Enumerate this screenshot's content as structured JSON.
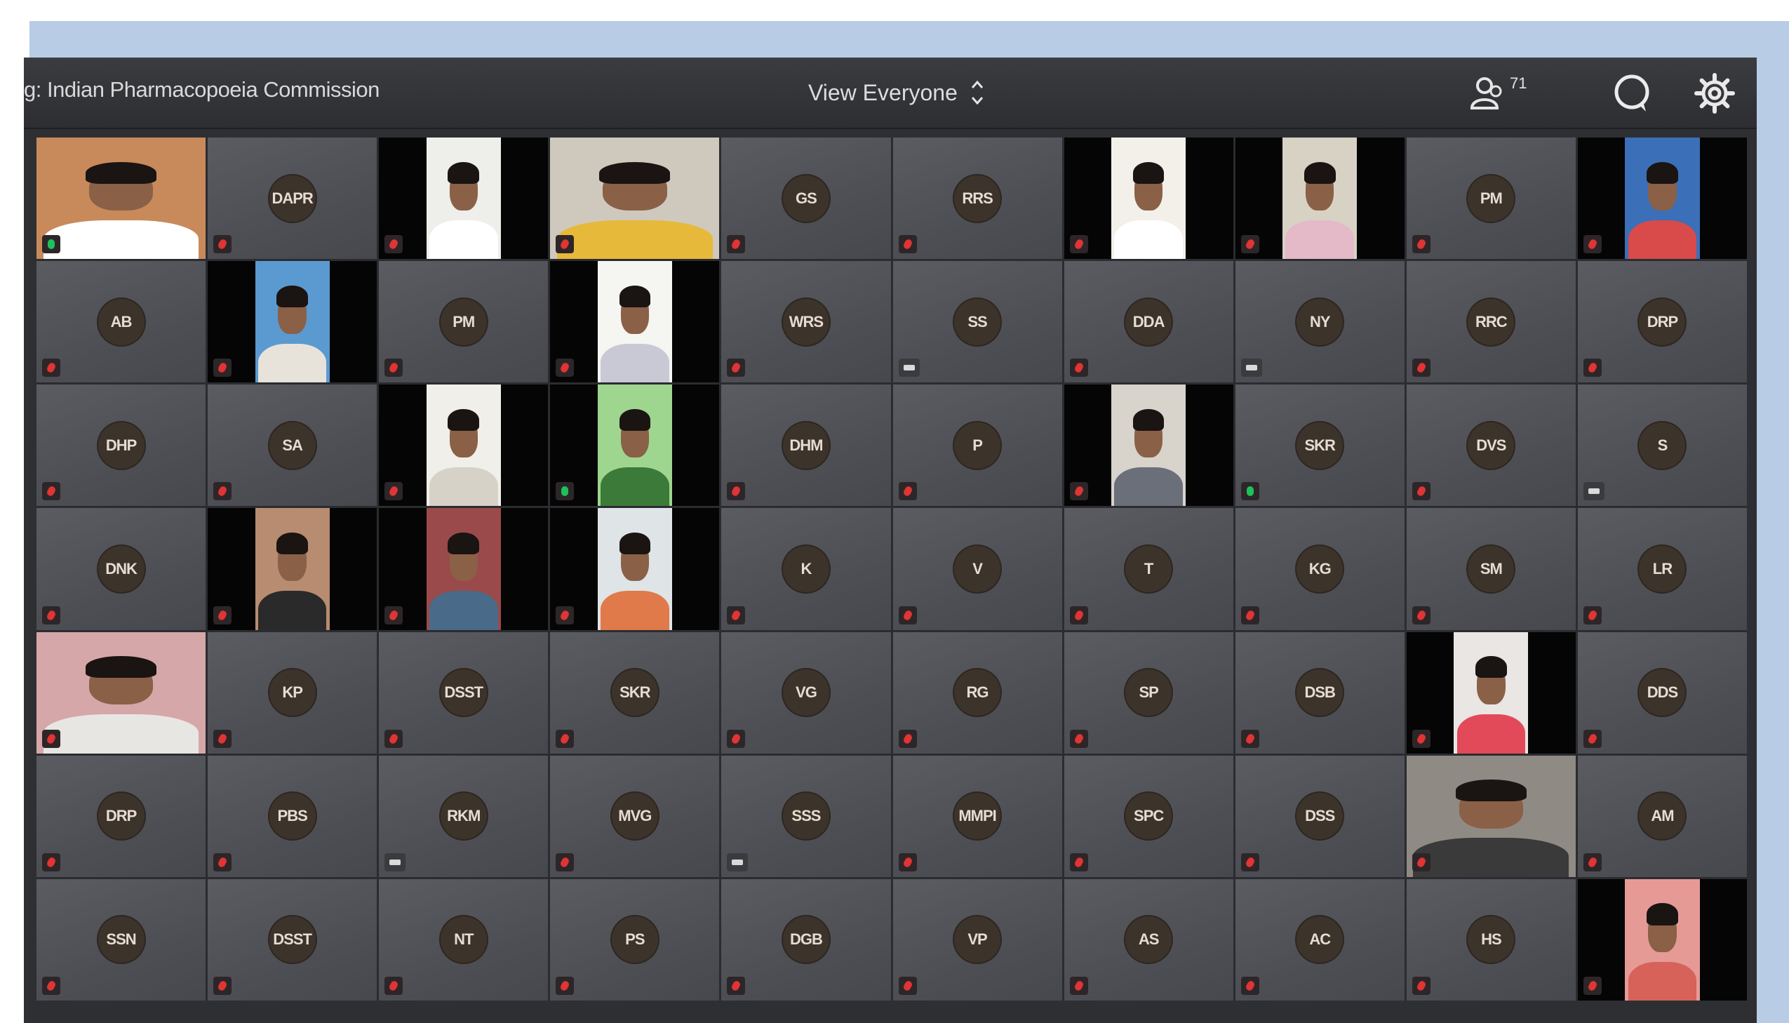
{
  "topbar": {
    "meeting_title": "g: Indian Pharmacopoeia Commission",
    "view_mode": "View Everyone",
    "view_arrows": "⌃⌄",
    "participant_count": "71",
    "icons": [
      "people-icon",
      "chat-icon",
      "settings-gear-icon"
    ]
  },
  "colors": {
    "tile_bg": "#54565c",
    "video_bg": "#050505",
    "avatar_bg": "#3c332b",
    "muted": "#e13434",
    "unmuted": "#1fc15a",
    "backdrop": "#b9cce6"
  },
  "tiles": [
    {
      "kind": "video",
      "layout": "wide",
      "bg": "#c88a5a",
      "shirt": "#ffffff",
      "mic": "unmuted"
    },
    {
      "kind": "avatar",
      "initials": "DAPR",
      "mic": "muted"
    },
    {
      "kind": "video",
      "layout": "portrait",
      "bg": "#eeeeea",
      "shirt": "#ffffff",
      "mic": "muted"
    },
    {
      "kind": "video",
      "layout": "wide",
      "bg": "#cfc9bd",
      "shirt": "#e6b93a",
      "mic": "muted"
    },
    {
      "kind": "avatar",
      "initials": "GS",
      "mic": "muted"
    },
    {
      "kind": "avatar",
      "initials": "RRS",
      "mic": "muted"
    },
    {
      "kind": "video",
      "layout": "portrait",
      "bg": "#f3f0ea",
      "shirt": "#ffffff",
      "mic": "muted"
    },
    {
      "kind": "video",
      "layout": "portrait",
      "bg": "#d8d2c4",
      "shirt": "#e4b9c8",
      "mic": "muted"
    },
    {
      "kind": "avatar",
      "initials": "PM",
      "mic": "muted"
    },
    {
      "kind": "video",
      "layout": "portrait",
      "bg": "#3b6fb8",
      "shirt": "#d94a4a",
      "mic": "muted"
    },
    {
      "kind": "avatar",
      "initials": "AB",
      "mic": "muted"
    },
    {
      "kind": "video",
      "layout": "portrait",
      "bg": "#5b9ad0",
      "shirt": "#e8e3da",
      "mic": "muted"
    },
    {
      "kind": "avatar",
      "initials": "PM",
      "mic": "muted"
    },
    {
      "kind": "video",
      "layout": "portrait",
      "bg": "#f5f5f2",
      "shirt": "#c9c9d6",
      "mic": "muted"
    },
    {
      "kind": "avatar",
      "initials": "WRS",
      "mic": "muted"
    },
    {
      "kind": "avatar",
      "initials": "SS",
      "mic": "chat"
    },
    {
      "kind": "avatar",
      "initials": "DDA",
      "mic": "muted"
    },
    {
      "kind": "avatar",
      "initials": "NY",
      "mic": "chat"
    },
    {
      "kind": "avatar",
      "initials": "RRC",
      "mic": "muted"
    },
    {
      "kind": "avatar",
      "initials": "DRP",
      "mic": "muted"
    },
    {
      "kind": "avatar",
      "initials": "DHP",
      "mic": "muted"
    },
    {
      "kind": "avatar",
      "initials": "SA",
      "mic": "muted"
    },
    {
      "kind": "video",
      "layout": "portrait",
      "bg": "#f0efe9",
      "shirt": "#d7d2c8",
      "mic": "muted"
    },
    {
      "kind": "video",
      "layout": "portrait",
      "bg": "#9fd68f",
      "shirt": "#3c7a3a",
      "mic": "unmuted"
    },
    {
      "kind": "avatar",
      "initials": "DHM",
      "mic": "muted"
    },
    {
      "kind": "avatar",
      "initials": "P",
      "mic": "muted"
    },
    {
      "kind": "video",
      "layout": "portrait",
      "bg": "#d8d3cb",
      "shirt": "#6a6f7a",
      "mic": "muted"
    },
    {
      "kind": "avatar",
      "initials": "SKR",
      "mic": "unmuted"
    },
    {
      "kind": "avatar",
      "initials": "DVS",
      "mic": "muted"
    },
    {
      "kind": "avatar",
      "initials": "S",
      "mic": "chat"
    },
    {
      "kind": "avatar",
      "initials": "DNK",
      "mic": "muted"
    },
    {
      "kind": "video",
      "layout": "portrait",
      "bg": "#b88c70",
      "shirt": "#2a2a2a",
      "mic": "muted"
    },
    {
      "kind": "video",
      "layout": "portrait",
      "bg": "#9a4a4a",
      "shirt": "#4a6a8a",
      "mic": "muted"
    },
    {
      "kind": "video",
      "layout": "portrait",
      "bg": "#dfe4e6",
      "shirt": "#e07a4a",
      "mic": "muted"
    },
    {
      "kind": "avatar",
      "initials": "K",
      "mic": "muted"
    },
    {
      "kind": "avatar",
      "initials": "V",
      "mic": "muted"
    },
    {
      "kind": "avatar",
      "initials": "T",
      "mic": "muted"
    },
    {
      "kind": "avatar",
      "initials": "KG",
      "mic": "muted"
    },
    {
      "kind": "avatar",
      "initials": "SM",
      "mic": "muted"
    },
    {
      "kind": "avatar",
      "initials": "LR",
      "mic": "muted"
    },
    {
      "kind": "video",
      "layout": "wide",
      "bg": "#d6a7a8",
      "shirt": "#e8e6e2",
      "mic": "muted"
    },
    {
      "kind": "avatar",
      "initials": "KP",
      "mic": "muted"
    },
    {
      "kind": "avatar",
      "initials": "DSST",
      "mic": "muted"
    },
    {
      "kind": "avatar",
      "initials": "SKR",
      "mic": "muted"
    },
    {
      "kind": "avatar",
      "initials": "VG",
      "mic": "muted"
    },
    {
      "kind": "avatar",
      "initials": "RG",
      "mic": "muted"
    },
    {
      "kind": "avatar",
      "initials": "SP",
      "mic": "muted"
    },
    {
      "kind": "avatar",
      "initials": "DSB",
      "mic": "muted"
    },
    {
      "kind": "video",
      "layout": "portrait",
      "bg": "#e9e6e4",
      "shirt": "#e24a5a",
      "mic": "muted"
    },
    {
      "kind": "avatar",
      "initials": "DDS",
      "mic": "muted"
    },
    {
      "kind": "avatar",
      "initials": "DRP",
      "mic": "muted"
    },
    {
      "kind": "avatar",
      "initials": "PBS",
      "mic": "muted"
    },
    {
      "kind": "avatar",
      "initials": "RKM",
      "mic": "chat"
    },
    {
      "kind": "avatar",
      "initials": "MVG",
      "mic": "muted"
    },
    {
      "kind": "avatar",
      "initials": "SSS",
      "mic": "chat"
    },
    {
      "kind": "avatar",
      "initials": "MMPI",
      "mic": "muted"
    },
    {
      "kind": "avatar",
      "initials": "SPC",
      "mic": "muted"
    },
    {
      "kind": "avatar",
      "initials": "DSS",
      "mic": "muted"
    },
    {
      "kind": "video",
      "layout": "wide",
      "bg": "#8f8a84",
      "shirt": "#3a3a3a",
      "mic": "muted"
    },
    {
      "kind": "avatar",
      "initials": "AM",
      "mic": "muted"
    },
    {
      "kind": "avatar",
      "initials": "SSN",
      "mic": "muted"
    },
    {
      "kind": "avatar",
      "initials": "DSST",
      "mic": "muted"
    },
    {
      "kind": "avatar",
      "initials": "NT",
      "mic": "muted"
    },
    {
      "kind": "avatar",
      "initials": "PS",
      "mic": "muted"
    },
    {
      "kind": "avatar",
      "initials": "DGB",
      "mic": "muted"
    },
    {
      "kind": "avatar",
      "initials": "VP",
      "mic": "muted"
    },
    {
      "kind": "avatar",
      "initials": "AS",
      "mic": "muted"
    },
    {
      "kind": "avatar",
      "initials": "AC",
      "mic": "muted"
    },
    {
      "kind": "avatar",
      "initials": "HS",
      "mic": "muted"
    },
    {
      "kind": "video",
      "layout": "portrait",
      "bg": "#e69a96",
      "shirt": "#d6625a",
      "mic": "muted"
    }
  ]
}
